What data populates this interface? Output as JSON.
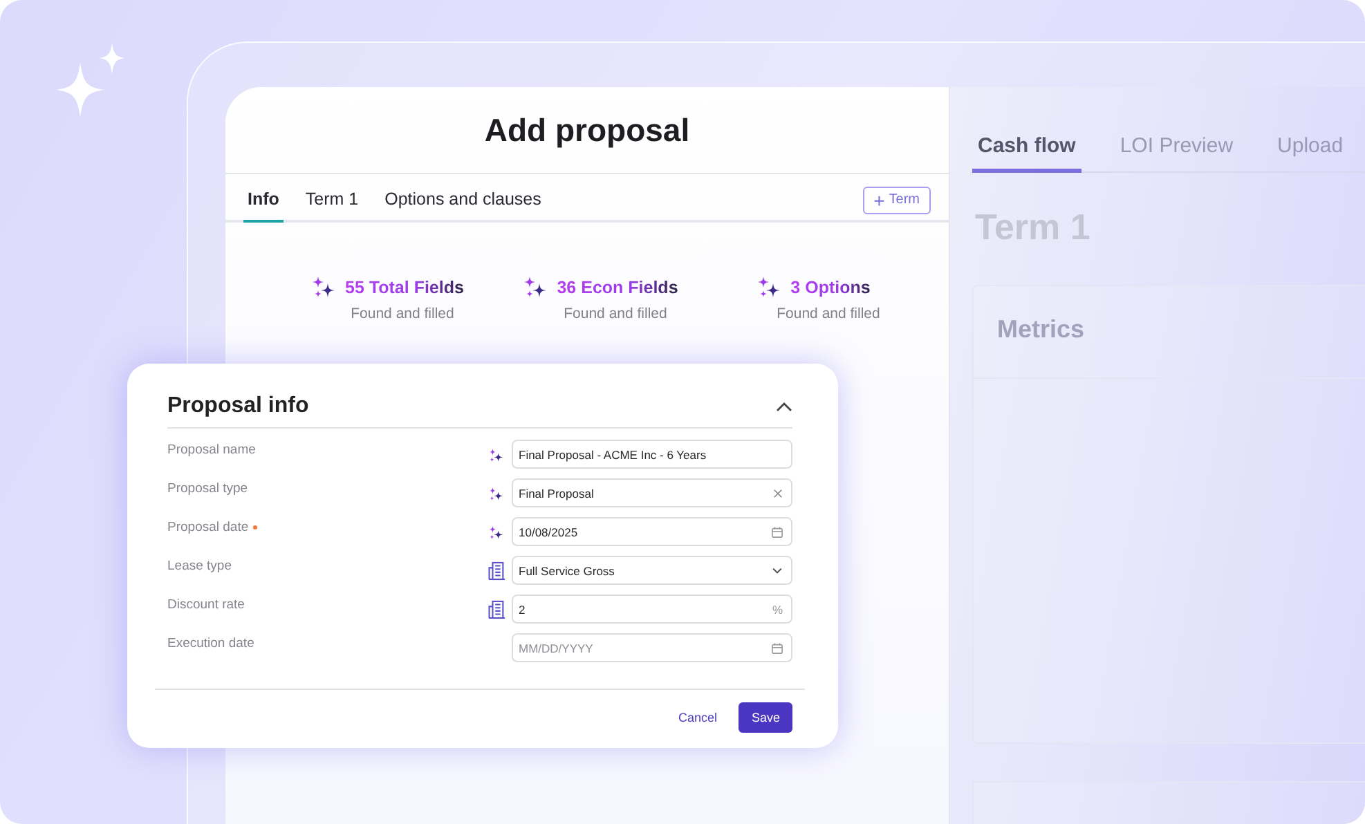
{
  "dialog": {
    "title": "Add proposal",
    "tabs": [
      {
        "label": "Info",
        "selected": true
      },
      {
        "label": "Term 1",
        "selected": false
      },
      {
        "label": "Options and clauses",
        "selected": false
      }
    ],
    "add_term_button": {
      "icon": "+",
      "label": "Term"
    },
    "stats": [
      {
        "value": "55 Total Fields",
        "caption": "Found and filled"
      },
      {
        "value": "36 Econ Fields",
        "caption": "Found and filled"
      },
      {
        "value": "3 Options",
        "caption": "Found and filled"
      }
    ]
  },
  "preview": {
    "tabs": [
      {
        "label": "Cash flow",
        "selected": true
      },
      {
        "label": "LOI Preview",
        "selected": false
      },
      {
        "label": "Upload",
        "selected": false
      }
    ],
    "heading": "Term 1",
    "card_title": "Metrics"
  },
  "proposal_info": {
    "title": "Proposal info",
    "expanded": true,
    "fields": [
      {
        "label": "Proposal name",
        "required": false,
        "source": {
          "kind": "ai"
        },
        "value": "Final Proposal - ACME Inc - 6 Years",
        "kind": "text"
      },
      {
        "label": "Proposal type",
        "required": false,
        "source": {
          "kind": "ai"
        },
        "value": "Final Proposal",
        "kind": "clear"
      },
      {
        "label": "Proposal date",
        "required": true,
        "source": {
          "kind": "ai"
        },
        "value": "10/08/2025",
        "kind": "date"
      },
      {
        "label": "Lease type",
        "required": false,
        "source": {
          "kind": "document"
        },
        "value": "Full Service Gross",
        "kind": "select"
      },
      {
        "label": "Discount rate",
        "required": false,
        "source": {
          "kind": "document"
        },
        "value": "2",
        "kind": "unit",
        "unit": "%"
      },
      {
        "label": "Execution date",
        "required": false,
        "placeholder": "MM/DD/YYYY",
        "kind": "date"
      }
    ],
    "buttons": [
      {
        "label": "Cancel",
        "kind": "link"
      },
      {
        "label": "Save",
        "kind": "primary"
      }
    ]
  }
}
